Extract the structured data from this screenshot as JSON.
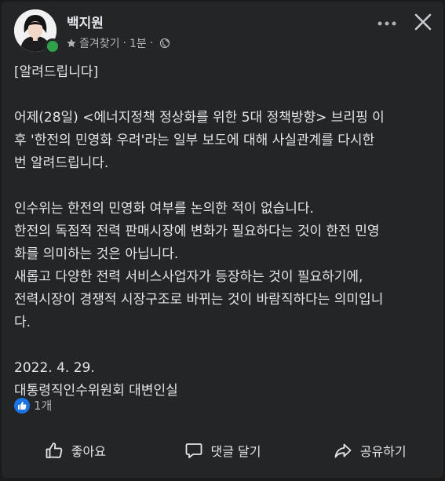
{
  "post": {
    "author": "백지원",
    "meta": {
      "favorites": "즐겨찾기",
      "separator": "·",
      "time": "1분",
      "separator2": "·"
    },
    "paragraphs": [
      "[알려드립니다]",
      "어제(28일) <에너지정책 정상화를 위한 5대 정책방향> 브리핑 이\n후 '한전의 민영화 우려'라는 일부 보도에 대해 사실관계를 다시한\n번 알려드립니다.",
      "인수위는 한전의 민영화 여부를 논의한 적이 없습니다.\n한전의 독점적 전력 판매시장에 변화가 필요하다는 것이 한전 민영\n화를 의미하는 것은 아닙니다.\n새롭고 다양한 전력 서비스사업자가 등장하는 것이 필요하기에,\n전력시장이 경쟁적 시장구조로 바뀌는 것이 바람직하다는 의미입니\n다.",
      "2022. 4. 29.\n대통령직인수위원회 대변인실"
    ],
    "reactions": {
      "count": "1개"
    },
    "actions": {
      "like": "좋아요",
      "comment": "댓글 달기",
      "share": "공유하기"
    }
  },
  "colors": {
    "background": "#242526",
    "text": "#e4e6eb",
    "secondary_text": "#b0b3b8",
    "like_blue": "#1b74e4",
    "online_green": "#31a24c"
  },
  "icons": [
    "star-icon",
    "globe-icon",
    "more-icon",
    "close-icon",
    "like-badge-icon",
    "thumbs-up-icon",
    "comment-icon",
    "share-icon"
  ]
}
